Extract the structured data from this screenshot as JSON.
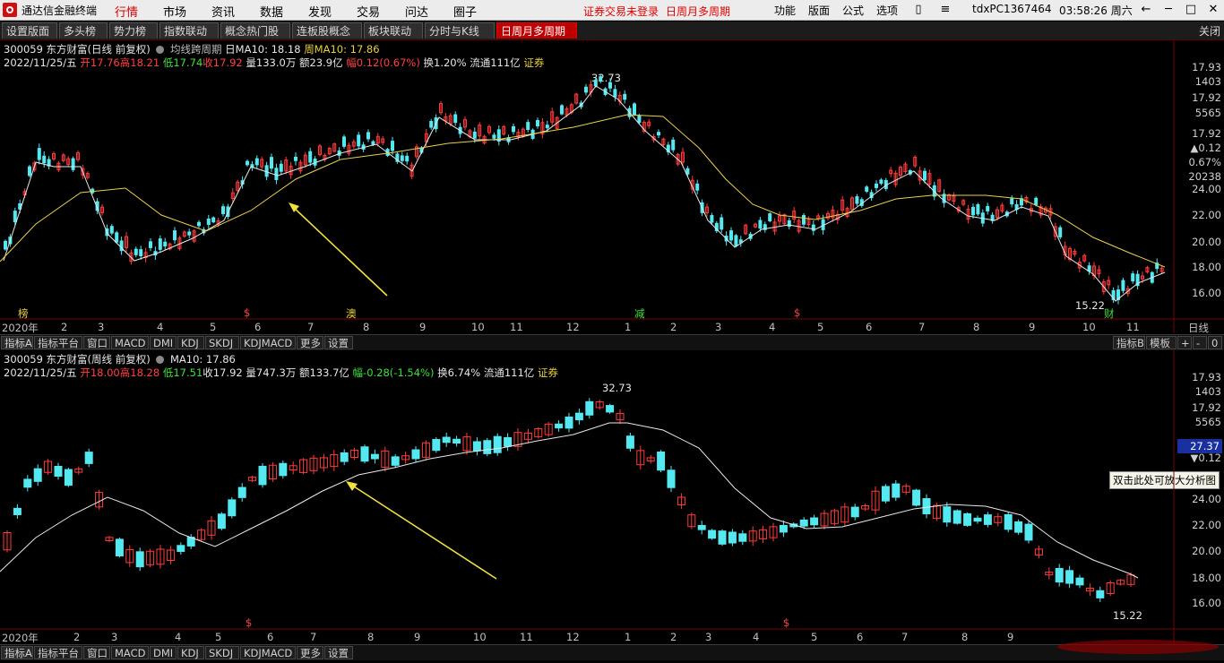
{
  "app": {
    "title": "通达信金融终端"
  },
  "menu": {
    "items": [
      "行情",
      "市场",
      "资讯",
      "数据",
      "发现",
      "交易",
      "问达",
      "圈子"
    ],
    "active": "行情",
    "status_red": [
      "证券交易未登录",
      "日周月多周期"
    ],
    "right": [
      "功能",
      "版面",
      "公式",
      "选项"
    ],
    "user": "tdxPC1367464",
    "clock": "03:58:26 周六"
  },
  "tabs": {
    "items": [
      "设置版面",
      "多头榜",
      "势力榜",
      "指数联动",
      "概念热门股",
      "连板股概念",
      "板块联动",
      "分时与K线",
      "日周月多周期"
    ],
    "active": "日周月多周期",
    "close": "关闭"
  },
  "top_panel": {
    "title_line": "300059 东方财富(日线 前复权)",
    "indicator": "均线跨周期",
    "ma_day": "日MA10: 18.18",
    "ma_week": "周MA10: 17.86",
    "date": "2022/11/25/五",
    "open": "开17.76",
    "high": "高18.21",
    "low": "低17.74",
    "close": "收17.92",
    "volume": "量133.0万",
    "amount": "额23.9亿",
    "change": "幅0.12(0.67%)",
    "turnover": "换1.20%",
    "float": "流通111亿",
    "sector": "证券",
    "right_axis": [
      "17.93",
      "1403",
      "17.92",
      "5565",
      "17.92",
      "▲0.12",
      "0.67%",
      "20238",
      "24.00",
      "22.00",
      "20.00",
      "18.00",
      "16.00"
    ],
    "max_label": "32.73",
    "min_label": "15.22",
    "markers": [
      "榜",
      "$",
      "澳",
      "减",
      "$",
      "财"
    ],
    "x_labels": [
      "2020年",
      "2",
      "3",
      "4",
      "5",
      "6",
      "7",
      "8",
      "9",
      "10",
      "11",
      "12",
      "1",
      "2",
      "3",
      "4",
      "5",
      "6",
      "7",
      "8",
      "9",
      "10",
      "11",
      "日线"
    ]
  },
  "indicator_tabs": [
    "指标A",
    "指标平台",
    "窗口",
    "MACD",
    "DMI",
    "KDJ",
    "SKDJ",
    "KDJMACD",
    "更多",
    "设置"
  ],
  "indicator_tabs_right": [
    "指标B",
    "模板",
    "+",
    "-",
    "0"
  ],
  "bottom_panel": {
    "title_line": "300059 东方财富(周线 前复权)",
    "ma": "MA10: 17.86",
    "date": "2022/11/25/五",
    "open": "开18.00",
    "high": "高18.28",
    "low": "低17.51",
    "close": "收17.92",
    "volume": "量747.3万",
    "amount": "额133.7亿",
    "change": "幅-0.28(-1.54%)",
    "turnover": "换6.74%",
    "float": "流通111亿",
    "sector": "证券",
    "right_axis": [
      "17.93",
      "1403",
      "17.92",
      "5565",
      "27.37",
      "▼0.12",
      "24.00",
      "22.00",
      "20.00",
      "18.00",
      "16.00"
    ],
    "max_label": "32.73",
    "min_label": "15.22",
    "tooltip": "双击此处可放大分析图",
    "markers": [
      "$",
      "$"
    ],
    "x_labels": [
      "2020年",
      "2",
      "3",
      "4",
      "5",
      "6",
      "7",
      "8",
      "9",
      "10",
      "11",
      "12",
      "1",
      "2",
      "3",
      "4",
      "5",
      "6",
      "7",
      "8",
      "9"
    ]
  },
  "colors": {
    "up": "#ff3b3b",
    "down": "#54e8f0",
    "ma_white": "#e8e8e8",
    "ma_yellow": "#e8d050",
    "arrow": "#f0e040",
    "accent": "#c00000"
  }
}
